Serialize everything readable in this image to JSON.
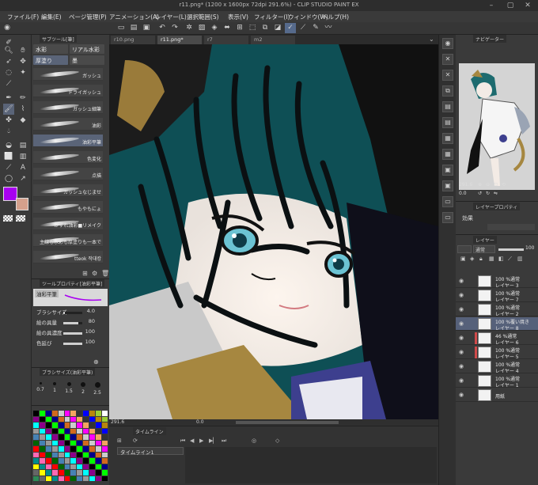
{
  "window": {
    "title": "r11.png* (1200 x 1600px 72dpi 291.6%) - CLIP STUDIO PAINT EX"
  },
  "menu": [
    "ファイル(F)",
    "編集(E)",
    "ページ管理(P)",
    "アニメーション(A)",
    "レイヤー(L)",
    "選択範囲(S)",
    "表示(V)",
    "フィルター(I)",
    "ウィンドウ(W)",
    "ヘルプ(H)"
  ],
  "subtool": {
    "tab_label": "サブツール[筆]",
    "groups": [
      "水彩",
      "リアル水彩",
      "厚塗り",
      "墨"
    ],
    "brushes": [
      {
        "label": "ガッシュ",
        "selected": false
      },
      {
        "label": "ドライガッシュ",
        "selected": false
      },
      {
        "label": "ガッシュ細筆",
        "selected": false
      },
      {
        "label": "油彩",
        "selected": false
      },
      {
        "label": "油彩平筆",
        "selected": true
      },
      {
        "label": "色変化",
        "selected": false
      },
      {
        "label": "点描",
        "selected": false
      },
      {
        "label": "ガッシュなじませ",
        "selected": false
      },
      {
        "label": "もやもにょ",
        "selected": false
      },
      {
        "label": "かすれ油彩■リメイク",
        "selected": false
      },
      {
        "label": "主線も水彩も厚塗りも一本で",
        "selected": false
      },
      {
        "label": "ttеok 작대캉",
        "selected": false
      }
    ]
  },
  "colors": {
    "main": "#a800f0",
    "sub": "#d4a08c"
  },
  "tool_property": {
    "tab_label": "ツールプロパティ[油彩平筆]",
    "preview_label": "油彩平筆",
    "rows": [
      {
        "label": "ブラシサイズ",
        "value": "4.0",
        "fraction": 0.08
      },
      {
        "label": "絵の具量",
        "value": "80",
        "fraction": 0.8
      },
      {
        "label": "絵の具濃度",
        "value": "100",
        "fraction": 1.0
      },
      {
        "label": "色延び",
        "value": "100",
        "fraction": 1.0
      }
    ]
  },
  "brush_size": {
    "tab_label": "ブラシサイズ(油彩平筆)",
    "sizes": [
      "0.7",
      "1",
      "1.5",
      "2",
      "2.5"
    ]
  },
  "documents": {
    "tabs": [
      {
        "label": "r10.png",
        "active": false
      },
      {
        "label": "r11.png*",
        "active": true
      },
      {
        "label": "r7",
        "active": false
      },
      {
        "label": "m2",
        "active": false
      }
    ]
  },
  "status": {
    "zoom": "291.6",
    "angle": "0.0"
  },
  "timeline": {
    "tab_label": "タイムライン",
    "select_value": "タイムライン1"
  },
  "navigator": {
    "tab_label": "ナビゲーター",
    "zoom": "291.6",
    "angle": "0.0"
  },
  "layer_property": {
    "tab_label": "レイヤープロパティ",
    "effect_label": "効果"
  },
  "layers_panel": {
    "tab_label": "レイヤー",
    "blend_mode": "通常",
    "opacity": "100",
    "layers": [
      {
        "opacity_blend": "100 %通常",
        "name": "レイヤー 3",
        "selected": false,
        "clip": false
      },
      {
        "opacity_blend": "100 %通常",
        "name": "レイヤー 7",
        "selected": false,
        "clip": false
      },
      {
        "opacity_blend": "100 %通常",
        "name": "レイヤー 2",
        "selected": false,
        "clip": false
      },
      {
        "opacity_blend": "100 %覆い焼き",
        "name": "レイヤー 8",
        "selected": true,
        "clip": false
      },
      {
        "opacity_blend": "46 %通常",
        "name": "レイヤー 6",
        "selected": false,
        "clip": true
      },
      {
        "opacity_blend": "100 %通常",
        "name": "レイヤー 5",
        "selected": false,
        "clip": true
      },
      {
        "opacity_blend": "100 %通常",
        "name": "レイヤー 4",
        "selected": false,
        "clip": false
      },
      {
        "opacity_blend": "100 %通常",
        "name": "レイヤー 1",
        "selected": false,
        "clip": false
      },
      {
        "opacity_blend": "",
        "name": "用紙",
        "selected": false,
        "clip": false
      }
    ]
  }
}
